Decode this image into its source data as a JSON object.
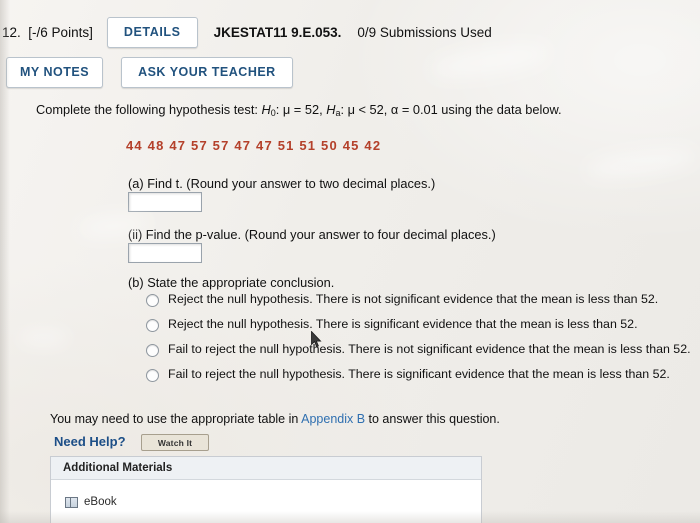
{
  "header": {
    "question_number": "12.",
    "points": "[-/6 Points]",
    "details_label": "DETAILS",
    "question_id": "JKESTAT11 9.E.053.",
    "submissions": "0/9 Submissions Used",
    "my_notes_label": "MY NOTES",
    "ask_teacher_label": "ASK YOUR TEACHER"
  },
  "problem": {
    "prompt_prefix": "Complete the following hypothesis test: ",
    "hypothesis_null": "H",
    "hypothesis_null_sub": "0",
    "hypothesis_null_body": ": μ = 52, ",
    "hypothesis_alt": "H",
    "hypothesis_alt_sub": "a",
    "hypothesis_alt_body": ": μ < 52, α = 0.01 using the data below.",
    "data_values": "44  48  47  57  57  47  47  51  51  50  45  42",
    "part_a_label": "(a) Find t. (Round your answer to two decimal places.)",
    "part_a_value": "",
    "part_a_placeholder": "",
    "part_ii_label": "(ii) Find the p-value. (Round your answer to four decimal places.)",
    "part_ii_value": "",
    "part_ii_placeholder": "",
    "part_b_label": "(b) State the appropriate conclusion.",
    "choices": [
      "Reject the null hypothesis. There is not significant evidence that the mean is less than 52.",
      "Reject the null hypothesis. There is significant evidence that the mean is less than 52.",
      "Fail to reject the null hypothesis. There is not significant evidence that the mean is less than 52.",
      "Fail to reject the null hypothesis. There is significant evidence that the mean is less than 52."
    ]
  },
  "footer": {
    "note_before_link": "You may need to use the appropriate table in ",
    "note_link": "Appendix B",
    "note_after_link": " to answer this question.",
    "need_help_label": "Need Help?",
    "watch_it_label": "Watch It",
    "additional_materials_label": "Additional Materials",
    "ebook_label": "eBook"
  },
  "colors": {
    "data_red": "#b4402a",
    "link_blue": "#2f6fb0",
    "button_text_blue": "#21527e",
    "need_help_blue": "#1c4e87"
  }
}
